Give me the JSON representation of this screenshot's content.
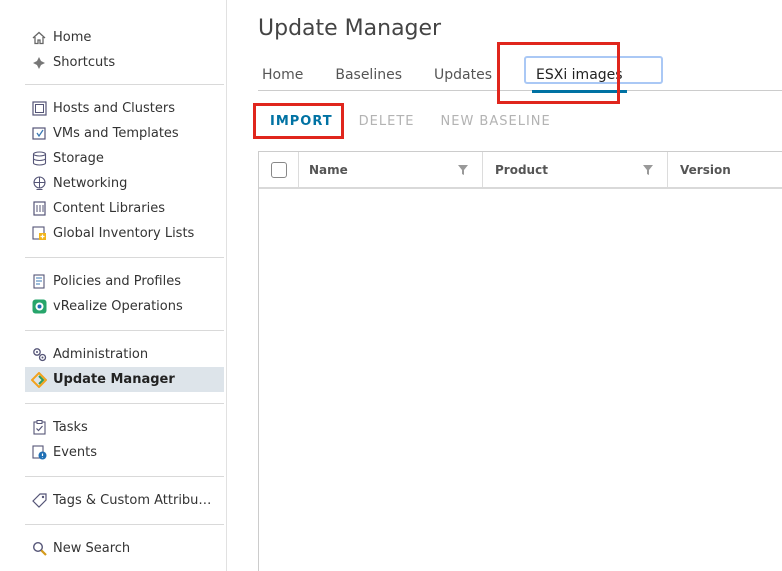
{
  "sidebar": {
    "groups": [
      [
        {
          "label": "Home",
          "icon": "home-icon"
        },
        {
          "label": "Shortcuts",
          "icon": "shortcuts-icon"
        }
      ],
      [
        {
          "label": "Hosts and Clusters",
          "icon": "hosts-clusters-icon"
        },
        {
          "label": "VMs and Templates",
          "icon": "vms-templates-icon"
        },
        {
          "label": "Storage",
          "icon": "storage-icon"
        },
        {
          "label": "Networking",
          "icon": "networking-icon"
        },
        {
          "label": "Content Libraries",
          "icon": "content-libraries-icon"
        },
        {
          "label": "Global Inventory Lists",
          "icon": "global-inventory-icon"
        }
      ],
      [
        {
          "label": "Policies and Profiles",
          "icon": "policies-icon"
        },
        {
          "label": "vRealize Operations",
          "icon": "vrealize-icon"
        }
      ],
      [
        {
          "label": "Administration",
          "icon": "administration-icon"
        },
        {
          "label": "Update Manager",
          "icon": "update-manager-icon",
          "active": true
        }
      ],
      [
        {
          "label": "Tasks",
          "icon": "tasks-icon"
        },
        {
          "label": "Events",
          "icon": "events-icon"
        }
      ],
      [
        {
          "label": "Tags & Custom Attribu…",
          "icon": "tags-icon"
        }
      ],
      [
        {
          "label": "New Search",
          "icon": "search-icon"
        }
      ]
    ]
  },
  "page": {
    "title": "Update Manager"
  },
  "tabs": [
    {
      "label": "Home"
    },
    {
      "label": "Baselines"
    },
    {
      "label": "Updates"
    },
    {
      "label": "ESXi images",
      "active": true
    }
  ],
  "actions": {
    "import": "IMPORT",
    "delete": "DELETE",
    "new_baseline": "NEW BASELINE"
  },
  "grid": {
    "columns": [
      "Name",
      "Product",
      "Version"
    ],
    "rows": []
  },
  "colors": {
    "accent": "#0072a3",
    "highlight": "#e0261d",
    "active_nav": "#dde4ea"
  }
}
